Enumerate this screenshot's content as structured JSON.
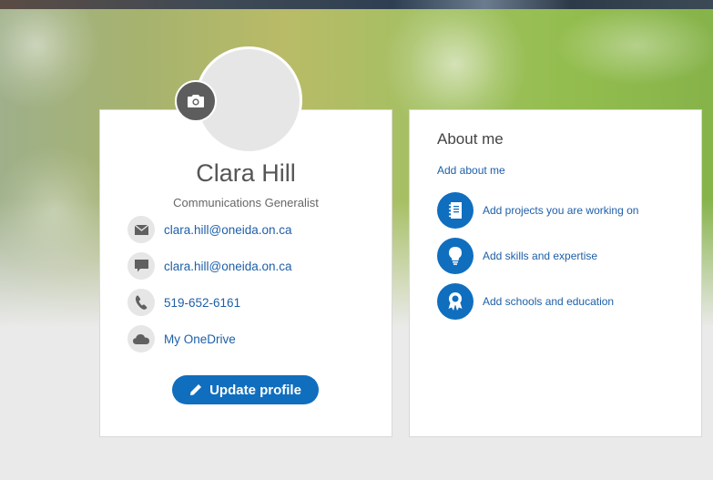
{
  "profile": {
    "name": "Clara Hill",
    "title": "Communications Generalist",
    "contacts": [
      {
        "icon": "mail-icon",
        "text": "clara.hill@oneida.on.ca"
      },
      {
        "icon": "chat-icon",
        "text": "clara.hill@oneida.on.ca"
      },
      {
        "icon": "phone-icon",
        "text": "519-652-6161"
      },
      {
        "icon": "cloud-icon",
        "text": "My OneDrive"
      }
    ],
    "update_label": "Update profile"
  },
  "about": {
    "title": "About me",
    "add_about_label": "Add about me",
    "items": [
      {
        "icon": "notebook-icon",
        "label": "Add projects you are working on"
      },
      {
        "icon": "lightbulb-icon",
        "label": "Add skills and expertise"
      },
      {
        "icon": "award-ribbon-icon",
        "label": "Add schools and education"
      }
    ]
  },
  "colors": {
    "accent": "#106ebe",
    "link": "#1e5fa8",
    "icon_bg": "#e6e6e6"
  }
}
